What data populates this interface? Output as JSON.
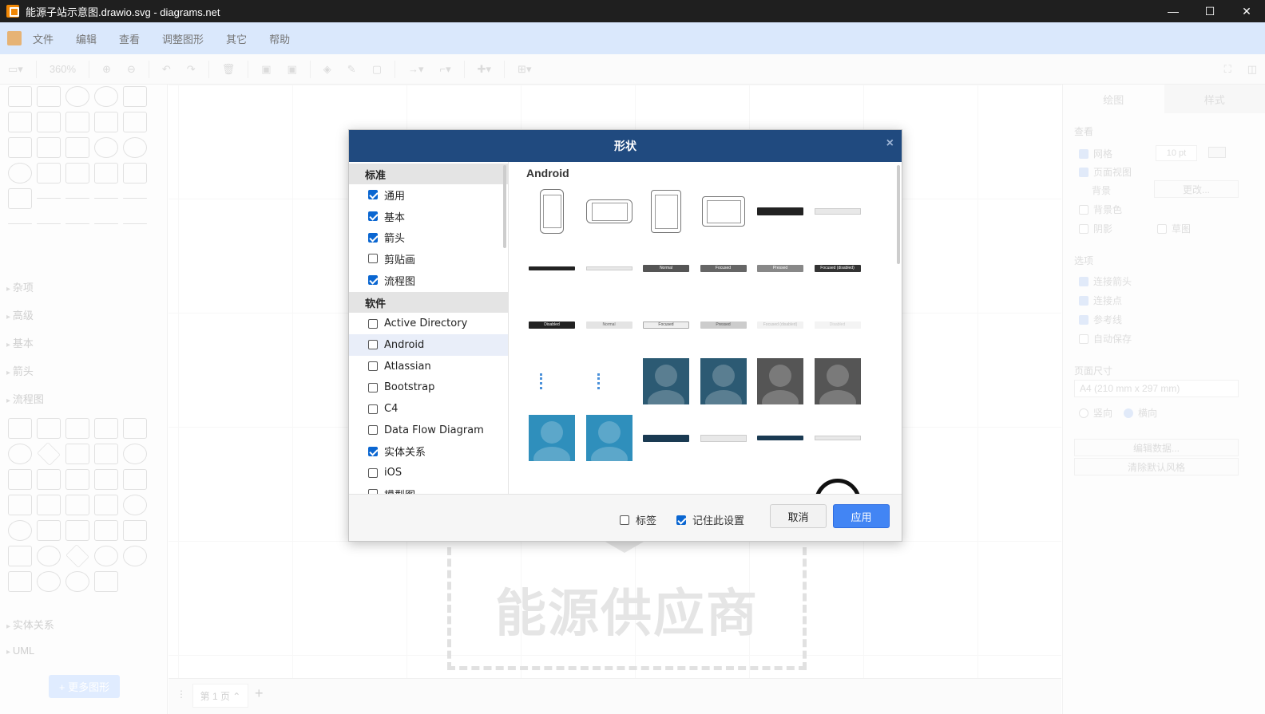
{
  "window": {
    "title": "能源子站示意图.drawio.svg - diagrams.net",
    "controls": [
      "—",
      "☐",
      "✕"
    ]
  },
  "menu": [
    "文件",
    "编辑",
    "查看",
    "调整图形",
    "其它",
    "帮助"
  ],
  "toolbar": {
    "zoom": "360%"
  },
  "sidebar": {
    "sections": [
      "杂项",
      "高级",
      "基本",
      "箭头",
      "流程图",
      "实体关系",
      "UML"
    ],
    "more_shapes": "+ 更多图形"
  },
  "canvas": {
    "shape_text": "能源供应商"
  },
  "pagebar": {
    "page_tab": "第 1 页 ⌃",
    "add": "+"
  },
  "format_panel": {
    "tabs": [
      "绘图",
      "样式"
    ],
    "view_heading": "查看",
    "grid": "网格",
    "grid_size": "10 pt",
    "page_view": "页面视图",
    "background": "背景",
    "change": "更改...",
    "background_color": "背景色",
    "shadow": "阴影",
    "sketch": "草图",
    "options_heading": "选项",
    "connection_arrows": "连接箭头",
    "connection_points": "连接点",
    "guides": "参考线",
    "autosave": "自动保存",
    "page_size_heading": "页面尺寸",
    "page_size_value": "A4 (210 mm x 297 mm)",
    "portrait": "竖向",
    "landscape": "横向",
    "edit_data": "编辑数据...",
    "clear_style": "清除默认风格"
  },
  "dialog": {
    "title": "形状",
    "close": "×",
    "groups": [
      {
        "name": "标准",
        "items": [
          {
            "label": "通用",
            "checked": true
          },
          {
            "label": "基本",
            "checked": true
          },
          {
            "label": "箭头",
            "checked": true
          },
          {
            "label": "剪贴画",
            "checked": false
          },
          {
            "label": "流程图",
            "checked": true
          }
        ]
      },
      {
        "name": "软件",
        "items": [
          {
            "label": "Active Directory",
            "checked": false
          },
          {
            "label": "Android",
            "checked": false
          },
          {
            "label": "Atlassian",
            "checked": false
          },
          {
            "label": "Bootstrap",
            "checked": false
          },
          {
            "label": "C4",
            "checked": false
          },
          {
            "label": "Data Flow Diagram",
            "checked": false
          },
          {
            "label": "实体关系",
            "checked": true
          },
          {
            "label": "iOS",
            "checked": false
          },
          {
            "label": "模型图",
            "checked": false
          }
        ]
      }
    ],
    "preview_title": "Android",
    "preview_button_labels": [
      "Normal",
      "Focused",
      "Pressed",
      "Focused (disabled)",
      "Disabled",
      "Normal",
      "Focused",
      "Pressed",
      "Focused (disabled)",
      "Disabled"
    ],
    "footer": {
      "labels_option": "标签",
      "labels_checked": false,
      "remember_option": "记住此设置",
      "remember_checked": true,
      "cancel": "取消",
      "apply": "应用"
    }
  },
  "colors": {
    "dialog_header": "#204a7f",
    "apply_button": "#4285f4",
    "menubar": "#dae8fc",
    "checkbox_checked": "#0a66d1"
  }
}
